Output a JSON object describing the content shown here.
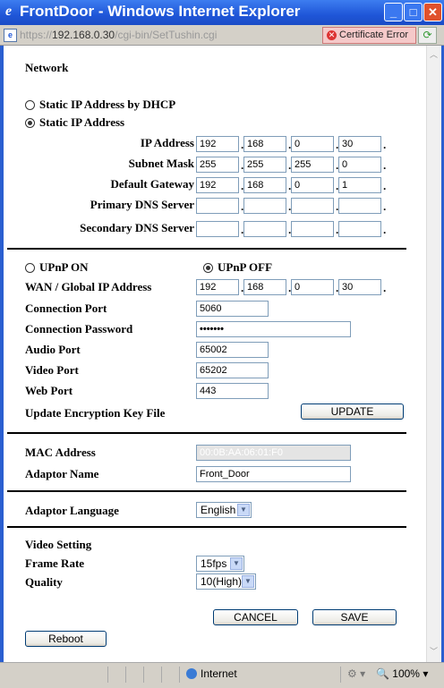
{
  "window": {
    "title": "FrontDoor - Windows Internet Explorer",
    "min": "_",
    "max": "□",
    "close": "✕"
  },
  "address": {
    "scheme": "https://",
    "host": "192.168.0.30",
    "path": "/cgi-bin/SetTushin.cgi",
    "cert_error": "Certificate Error"
  },
  "network": {
    "heading": "Network",
    "dhcp_label": "Static IP Address by DHCP",
    "static_label": "Static IP Address",
    "ip_label": "IP Address",
    "ip": [
      "192",
      "168",
      "0",
      "30"
    ],
    "mask_label": "Subnet Mask",
    "mask": [
      "255",
      "255",
      "255",
      "0"
    ],
    "gw_label": "Default Gateway",
    "gw": [
      "192",
      "168",
      "0",
      "1"
    ],
    "dns1_label": "Primary DNS Server",
    "dns2_label": "Secondary DNS Server"
  },
  "upnp": {
    "on_label": "UPnP ON",
    "off_label": "UPnP OFF",
    "wan_label": "WAN / Global IP Address",
    "wan": [
      "192",
      "168",
      "0",
      "30"
    ],
    "conn_port_label": "Connection Port",
    "conn_port": "5060",
    "conn_pw_label": "Connection Password",
    "conn_pw": "•••••••",
    "audio_label": "Audio Port",
    "audio_port": "65002",
    "video_label": "Video Port",
    "video_port": "65202",
    "web_label": "Web Port",
    "web_port": "443",
    "enc_label": "Update Encryption Key File",
    "update_btn": "UPDATE"
  },
  "adaptor": {
    "mac_label": "MAC Address",
    "mac": "00:0B:AA:06:01:F0",
    "name_label": "Adaptor Name",
    "name": "Front_Door",
    "lang_label": "Adaptor Language",
    "lang": "English"
  },
  "video": {
    "heading": "Video Setting",
    "rate_label": "Frame Rate",
    "rate": "15fps",
    "quality_label": "Quality",
    "quality": "10(High)"
  },
  "buttons": {
    "cancel": "CANCEL",
    "save": "SAVE",
    "reboot": "Reboot"
  },
  "status": {
    "zone": "Internet",
    "zoom": "100%"
  }
}
